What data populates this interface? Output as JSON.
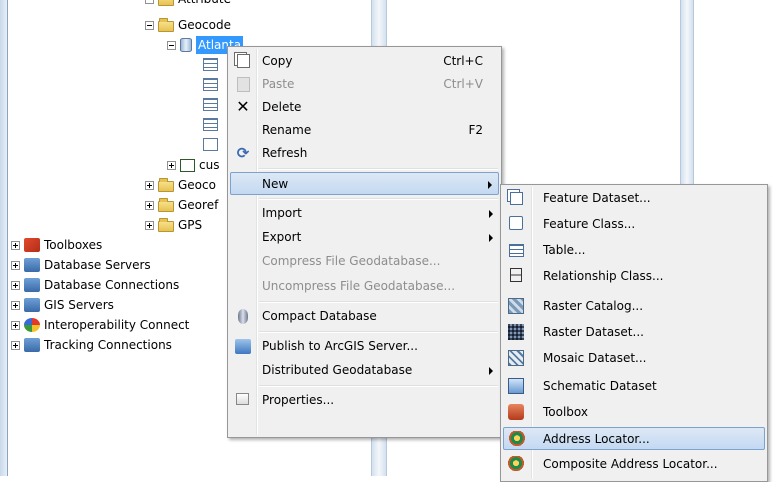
{
  "tree": {
    "top_partial_label": "Attribute",
    "items": [
      {
        "label": "Geocode",
        "icon": "folder-icon",
        "expander": "minus"
      },
      {
        "label": "Atlanta",
        "icon": "geodatabase-icon",
        "expander": "minus",
        "selected": true
      },
      {
        "label": "",
        "icon": "table-icon"
      },
      {
        "label": "",
        "icon": "table-icon"
      },
      {
        "label": "",
        "icon": "table-icon"
      },
      {
        "label": "",
        "icon": "table-icon"
      },
      {
        "label": "",
        "icon": "relationship-icon"
      },
      {
        "label": "cus",
        "icon": "dataset-icon",
        "expander": "plus"
      },
      {
        "label": "Geoco",
        "icon": "folder-icon",
        "expander": "plus"
      },
      {
        "label": "Georef",
        "icon": "folder-icon",
        "expander": "plus"
      },
      {
        "label": "GPS",
        "icon": "folder-icon",
        "expander": "plus"
      },
      {
        "label": "Toolboxes",
        "icon": "toolboxes-icon",
        "expander": "plus"
      },
      {
        "label": "Database Servers",
        "icon": "database-servers-icon",
        "expander": "plus"
      },
      {
        "label": "Database Connections",
        "icon": "database-connections-icon",
        "expander": "plus"
      },
      {
        "label": "GIS Servers",
        "icon": "gis-servers-icon",
        "expander": "plus"
      },
      {
        "label": "Interoperability Connect",
        "icon": "interoperability-icon",
        "expander": "plus"
      },
      {
        "label": "Tracking Connections",
        "icon": "tracking-connections-icon",
        "expander": "plus"
      }
    ]
  },
  "context_menu": {
    "items": [
      {
        "label": "Copy",
        "shortcut": "Ctrl+C",
        "icon": "copy-icon",
        "enabled": true
      },
      {
        "label": "Paste",
        "shortcut": "Ctrl+V",
        "icon": "paste-icon",
        "enabled": false
      },
      {
        "label": "Delete",
        "shortcut": "",
        "icon": "delete-icon",
        "enabled": true
      },
      {
        "label": "Rename",
        "shortcut": "F2",
        "icon": "",
        "enabled": true
      },
      {
        "label": "Refresh",
        "shortcut": "",
        "icon": "refresh-icon",
        "enabled": true
      },
      {
        "label": "New",
        "submenu": true,
        "hover": true
      },
      {
        "label": "Import",
        "submenu": true
      },
      {
        "label": "Export",
        "submenu": true
      },
      {
        "label": "Compress File Geodatabase...",
        "enabled": false
      },
      {
        "label": "Uncompress File Geodatabase...",
        "enabled": false
      },
      {
        "label": "Compact Database",
        "icon": "compact-database-icon"
      },
      {
        "label": "Publish to ArcGIS Server...",
        "icon": "publish-icon"
      },
      {
        "label": "Distributed Geodatabase",
        "submenu": true
      },
      {
        "label": "Properties...",
        "icon": "properties-icon"
      }
    ]
  },
  "new_submenu": {
    "items": [
      {
        "label": "Feature Dataset...",
        "icon": "feature-dataset-icon"
      },
      {
        "label": "Feature Class...",
        "icon": "feature-class-icon"
      },
      {
        "label": "Table...",
        "icon": "table-icon"
      },
      {
        "label": "Relationship Class...",
        "icon": "relationship-class-icon"
      },
      {
        "label": "Raster Catalog...",
        "icon": "raster-catalog-icon"
      },
      {
        "label": "Raster Dataset...",
        "icon": "raster-dataset-icon"
      },
      {
        "label": "Mosaic Dataset...",
        "icon": "mosaic-dataset-icon"
      },
      {
        "label": "Schematic Dataset",
        "icon": "schematic-dataset-icon"
      },
      {
        "label": "Toolbox",
        "icon": "toolbox-icon"
      },
      {
        "label": "Address Locator...",
        "icon": "address-locator-icon",
        "hover": true
      },
      {
        "label": "Composite Address Locator...",
        "icon": "composite-address-locator-icon"
      }
    ]
  },
  "colors": {
    "selection": "#3399ff",
    "menu_bg": "#f0f0f0",
    "hover_border": "#7da2ce",
    "disabled_text": "#8d8d8d"
  }
}
